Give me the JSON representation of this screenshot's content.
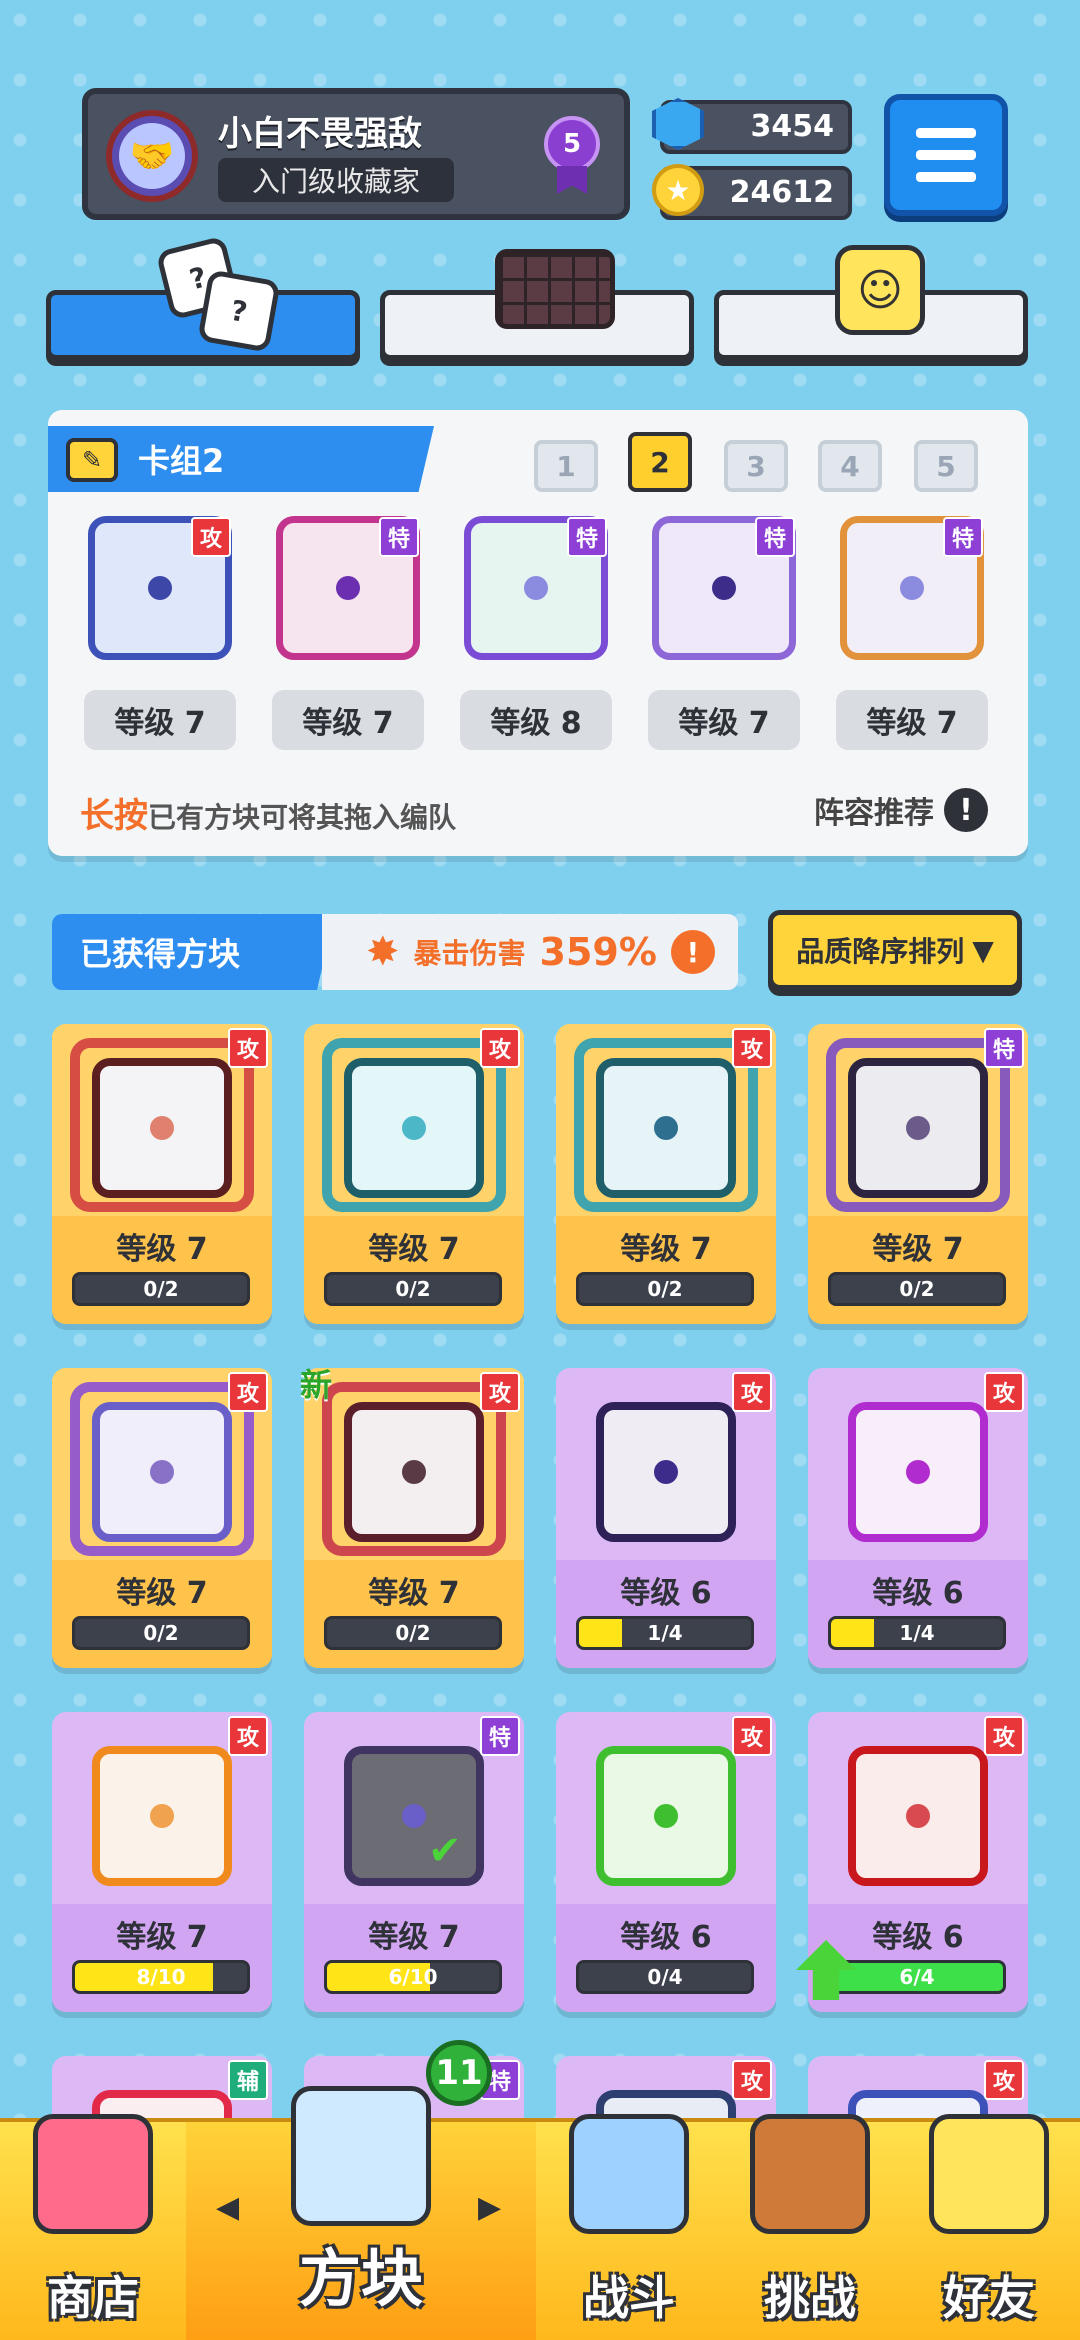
{
  "profile": {
    "name": "小白不畏强敌",
    "title": "入门级收藏家",
    "rank": "5"
  },
  "currency": {
    "gems": "3454",
    "coins": "24612"
  },
  "deck": {
    "title": "卡组2",
    "numbers": [
      "1",
      "2",
      "3",
      "4",
      "5"
    ],
    "active_number": "2",
    "cards": [
      {
        "tag": "攻",
        "level": "等级 7"
      },
      {
        "tag": "特",
        "level": "等级 7"
      },
      {
        "tag": "特",
        "level": "等级 8"
      },
      {
        "tag": "特",
        "level": "等级 7"
      },
      {
        "tag": "特",
        "level": "等级 7"
      }
    ],
    "hint_highlight": "长按",
    "hint_rest": "已有方块可将其拖入编队",
    "recommend": "阵容推荐"
  },
  "obtained": {
    "title": "已获得方块",
    "crit_label": "暴击伤害",
    "crit_value": "359%",
    "sort_label": "品质降序排列"
  },
  "cards": [
    {
      "tag": "攻",
      "level": "等级 7",
      "progress": "0/2",
      "fill": 0
    },
    {
      "tag": "攻",
      "level": "等级 7",
      "progress": "0/2",
      "fill": 0
    },
    {
      "tag": "攻",
      "level": "等级 7",
      "progress": "0/2",
      "fill": 0
    },
    {
      "tag": "特",
      "level": "等级 7",
      "progress": "0/2",
      "fill": 0
    },
    {
      "tag": "攻",
      "level": "等级 7",
      "progress": "0/2",
      "fill": 0
    },
    {
      "tag": "攻",
      "level": "等级 7",
      "progress": "0/2",
      "fill": 0,
      "new": "新"
    },
    {
      "tag": "攻",
      "level": "等级 6",
      "progress": "1/4",
      "fill": 0.25
    },
    {
      "tag": "攻",
      "level": "等级 6",
      "progress": "1/4",
      "fill": 0.25
    },
    {
      "tag": "攻",
      "level": "等级 7",
      "progress": "8/10",
      "fill": 0.8
    },
    {
      "tag": "特",
      "level": "等级 7",
      "progress": "6/10",
      "fill": 0.6
    },
    {
      "tag": "攻",
      "level": "等级 6",
      "progress": "0/4",
      "fill": 0
    },
    {
      "tag": "攻",
      "level": "等级 6",
      "progress": "6/4",
      "fill": 1.0
    }
  ],
  "peek_tags": [
    "辅",
    "特",
    "攻",
    "攻"
  ],
  "nav": {
    "shop": "商店",
    "blocks": "方块",
    "battle": "战斗",
    "challenge": "挑战",
    "friends": "好友",
    "badge": "11"
  },
  "colors": {
    "accent_blue": "#2d8ef0",
    "attack_tag": "#e8363b",
    "special_tag": "#8e3fd6",
    "support_tag": "#1fae7b",
    "legend_card": "#ffd36a",
    "epic_card": "#dcb8f5",
    "crit_orange": "#f36f2a"
  }
}
